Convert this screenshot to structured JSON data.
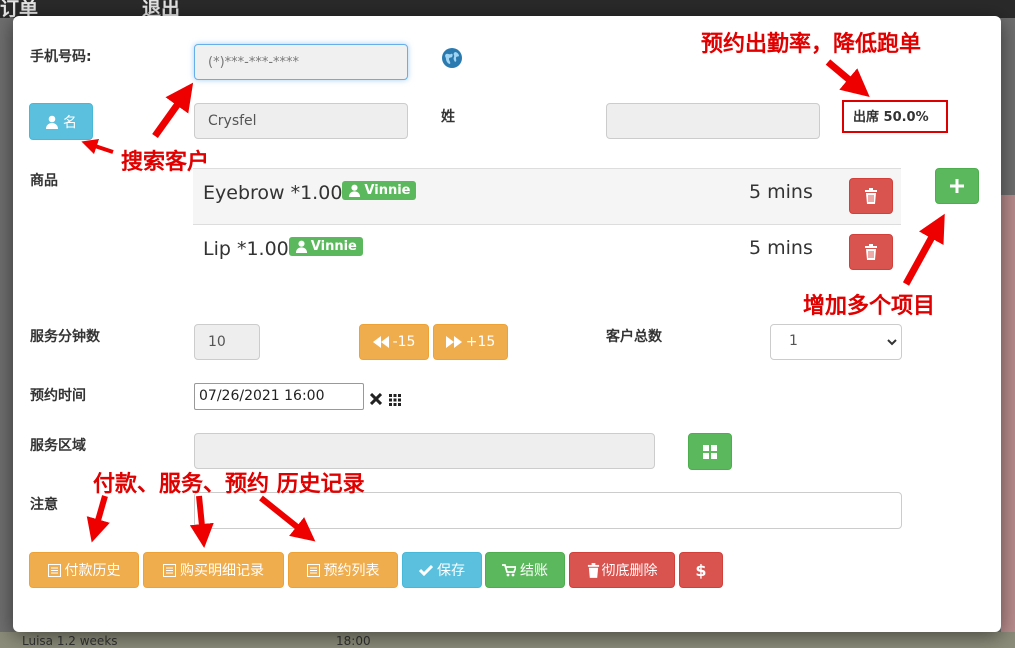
{
  "background": {
    "nav": [
      "订单",
      "退出"
    ],
    "bottom_row": [
      "Luisa 1.2 weeks",
      "18:00"
    ]
  },
  "form": {
    "phone_label": "手机号码:",
    "phone_placeholder": "(*)***-***-****",
    "first_name_button": "名",
    "first_name_value": "Crysfel",
    "last_name_label": "姓",
    "last_name_value": "",
    "attendance": "出席 50.0%",
    "services_label": "商品",
    "services": [
      {
        "name": "Eyebrow *1.00",
        "staff": "Vinnie",
        "duration": "5 mins"
      },
      {
        "name": "Lip *1.00",
        "staff": "Vinnie",
        "duration": "5 mins"
      }
    ],
    "minutes_label": "服务分钟数",
    "minutes_value": "10",
    "minus_label": "-15",
    "plus_label": "+15",
    "customers_label": "客户总数",
    "customers_value": "1",
    "time_label": "预约时间",
    "time_value": "07/26/2021 16:00",
    "area_label": "服务区域",
    "note_label": "注意",
    "note_value": ""
  },
  "buttons": {
    "payment_history": "付款历史",
    "purchase_history": "购买明细记录",
    "appointment_list": "预约列表",
    "save": "保存",
    "checkout": "结账",
    "delete": "彻底删除",
    "pay": "$"
  },
  "annotations": {
    "attendance_note": "预约出勤率，降低跑单",
    "search_note": "搜索客户",
    "add_items_note": "增加多个项目",
    "history_note": "付款、服务、预约 历史记录"
  },
  "colors": {
    "info": "#5bc0de",
    "warning": "#f0ad4e",
    "success": "#5cb85c",
    "danger": "#d9534f",
    "annotation": "#e00000"
  }
}
